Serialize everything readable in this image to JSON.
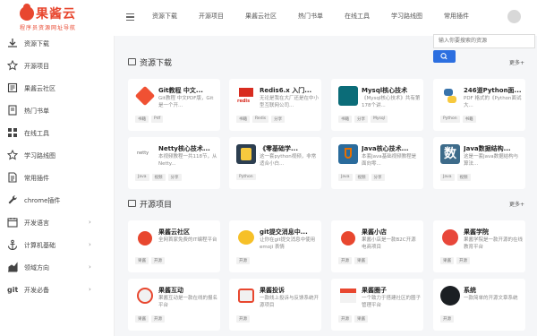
{
  "header": {
    "logo_title": "果酱云",
    "logo_subtitle": "程序员资源网址导航",
    "nav": [
      "资源下载",
      "开源项目",
      "果酱云社区",
      "热门书单",
      "在线工具",
      "学习路线图",
      "常用插件"
    ]
  },
  "search": {
    "placeholder": "输入你要搜索的资源"
  },
  "sidebar": {
    "items": [
      {
        "label": "资源下载",
        "icon": "download-icon",
        "has_arrow": false
      },
      {
        "label": "开源项目",
        "icon": "star-icon",
        "has_arrow": false
      },
      {
        "label": "果酱云社区",
        "icon": "community-icon",
        "has_arrow": false
      },
      {
        "label": "热门书单",
        "icon": "book-icon",
        "has_arrow": false
      },
      {
        "label": "在线工具",
        "icon": "grid-icon",
        "has_arrow": false
      },
      {
        "label": "学习路线图",
        "icon": "star-icon",
        "has_arrow": false
      },
      {
        "label": "常用插件",
        "icon": "document-icon",
        "has_arrow": false
      },
      {
        "label": "chrome插件",
        "icon": "wrench-icon",
        "has_arrow": false
      },
      {
        "label": "开发语言",
        "icon": "calendar-icon",
        "has_arrow": true
      },
      {
        "label": "计算机基础",
        "icon": "anchor-icon",
        "has_arrow": true
      },
      {
        "label": "领域方向",
        "icon": "chart-icon",
        "has_arrow": true
      },
      {
        "label": "开发必备",
        "icon": "git-icon",
        "has_arrow": true
      }
    ]
  },
  "sections": [
    {
      "title": "资源下载",
      "more": "更多+",
      "cards": [
        {
          "title": "Git教程 中文...",
          "desc": "Git教程 中文PDF版，Git是一个开...",
          "tags": [
            "书籍",
            "Pdf"
          ],
          "thumb": "git-logo"
        },
        {
          "title": "Redis6.x 入门...",
          "desc": "无论是我在大厂还是在中小型互联网公司...",
          "tags": [
            "书籍",
            "Redis",
            "分享"
          ],
          "thumb": "redis-logo"
        },
        {
          "title": "Mysql核心技术",
          "desc": "《Mysql核心技术》共有第178个讲...",
          "tags": [
            "书籍",
            "分享",
            "Mysql"
          ],
          "thumb": "mysql-logo"
        },
        {
          "title": "246道Python面...",
          "desc": "PDF 格式的《Python面试大...",
          "tags": [
            "Python",
            "书籍"
          ],
          "thumb": "python-logo"
        },
        {
          "title": "Netty核心技术...",
          "desc": "本视频教程一共118节，从Netty...",
          "tags": [
            "Java",
            "视频",
            "分享"
          ],
          "thumb": "netty-logo"
        },
        {
          "title": "《零基础学...",
          "desc": "这一套python视频，非常适合小白...",
          "tags": [
            "Python"
          ],
          "thumb": "python-book"
        },
        {
          "title": "Java核心技术...",
          "desc": "本套Java基础视频教程是面向零...",
          "tags": [
            "Java",
            "视频",
            "分享"
          ],
          "thumb": "java-logo"
        },
        {
          "title": "Java数据结构...",
          "desc": "这是一套Java数据结构与算法...",
          "tags": [
            "Java",
            "视频"
          ],
          "thumb": "shu-logo"
        }
      ]
    },
    {
      "title": "开源项目",
      "more": "更多+",
      "cards": [
        {
          "title": "果酱云社区",
          "desc": "全网首家免费的IT编程平台",
          "tags": [
            "果酱",
            "开源"
          ],
          "thumb": "jam-red"
        },
        {
          "title": "git提交消息中...",
          "desc": "让你在git提交消息中使用 emoji 表情",
          "tags": [
            "开源"
          ],
          "thumb": "emoji"
        },
        {
          "title": "果酱小店",
          "desc": "果酱小店是一款B2C开源电商项目",
          "tags": [
            "开源",
            "果酱"
          ],
          "thumb": "jam-red2"
        },
        {
          "title": "果酱学院",
          "desc": "果酱学院是一款开源的在线教育平台",
          "tags": [
            "果酱",
            "开源"
          ],
          "thumb": "edu"
        },
        {
          "title": "果酱互动",
          "desc": "果酱互动是一款在线的报名平台",
          "tags": [
            "果酱",
            "开源"
          ],
          "thumb": "interact"
        },
        {
          "title": "果酱投诉",
          "desc": "一款线上投诉与反馈系统开源项目",
          "tags": [
            "开源"
          ],
          "thumb": "complain"
        },
        {
          "title": "果酱圈子",
          "desc": "一个致力于搭建社区的圈子管理平台",
          "tags": [
            "开源",
            "果酱"
          ],
          "thumb": "circle"
        },
        {
          "title": "系统",
          "desc": "一款简单的开源文章系统",
          "tags": [
            "开源"
          ],
          "thumb": "github"
        }
      ]
    }
  ],
  "colors": {
    "brand": "#e8472f",
    "accent": "#2c6fe0"
  }
}
